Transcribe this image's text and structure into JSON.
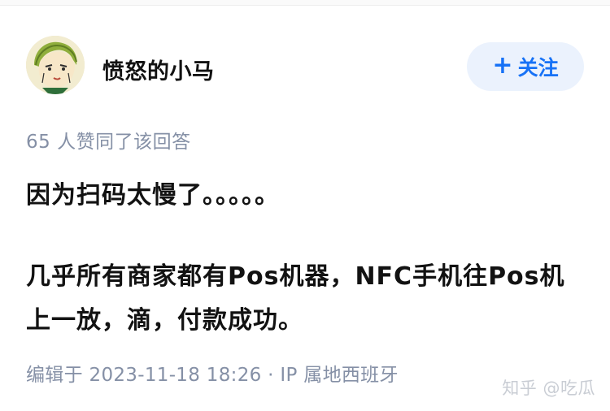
{
  "author": {
    "name": "愤怒的小马",
    "avatar_icon": "cartoon-avatar-icon"
  },
  "follow": {
    "plus": "+",
    "label": "关注"
  },
  "votes": {
    "text": "65 人赞同了该回答"
  },
  "answer": {
    "paragraph_1": "因为扫码太慢了。。。。。",
    "paragraph_2": "几乎所有商家都有Pos机器，NFC手机往Pos机上一放，滴，付款成功。"
  },
  "meta": {
    "edited": "编辑于 2023-11-18 18:26 · IP 属地西班牙"
  },
  "watermark": {
    "text": "知乎 @吃瓜"
  },
  "colors": {
    "accent": "#1772f6",
    "follow_bg": "#ebf2fd",
    "muted_text": "#8590a6"
  }
}
